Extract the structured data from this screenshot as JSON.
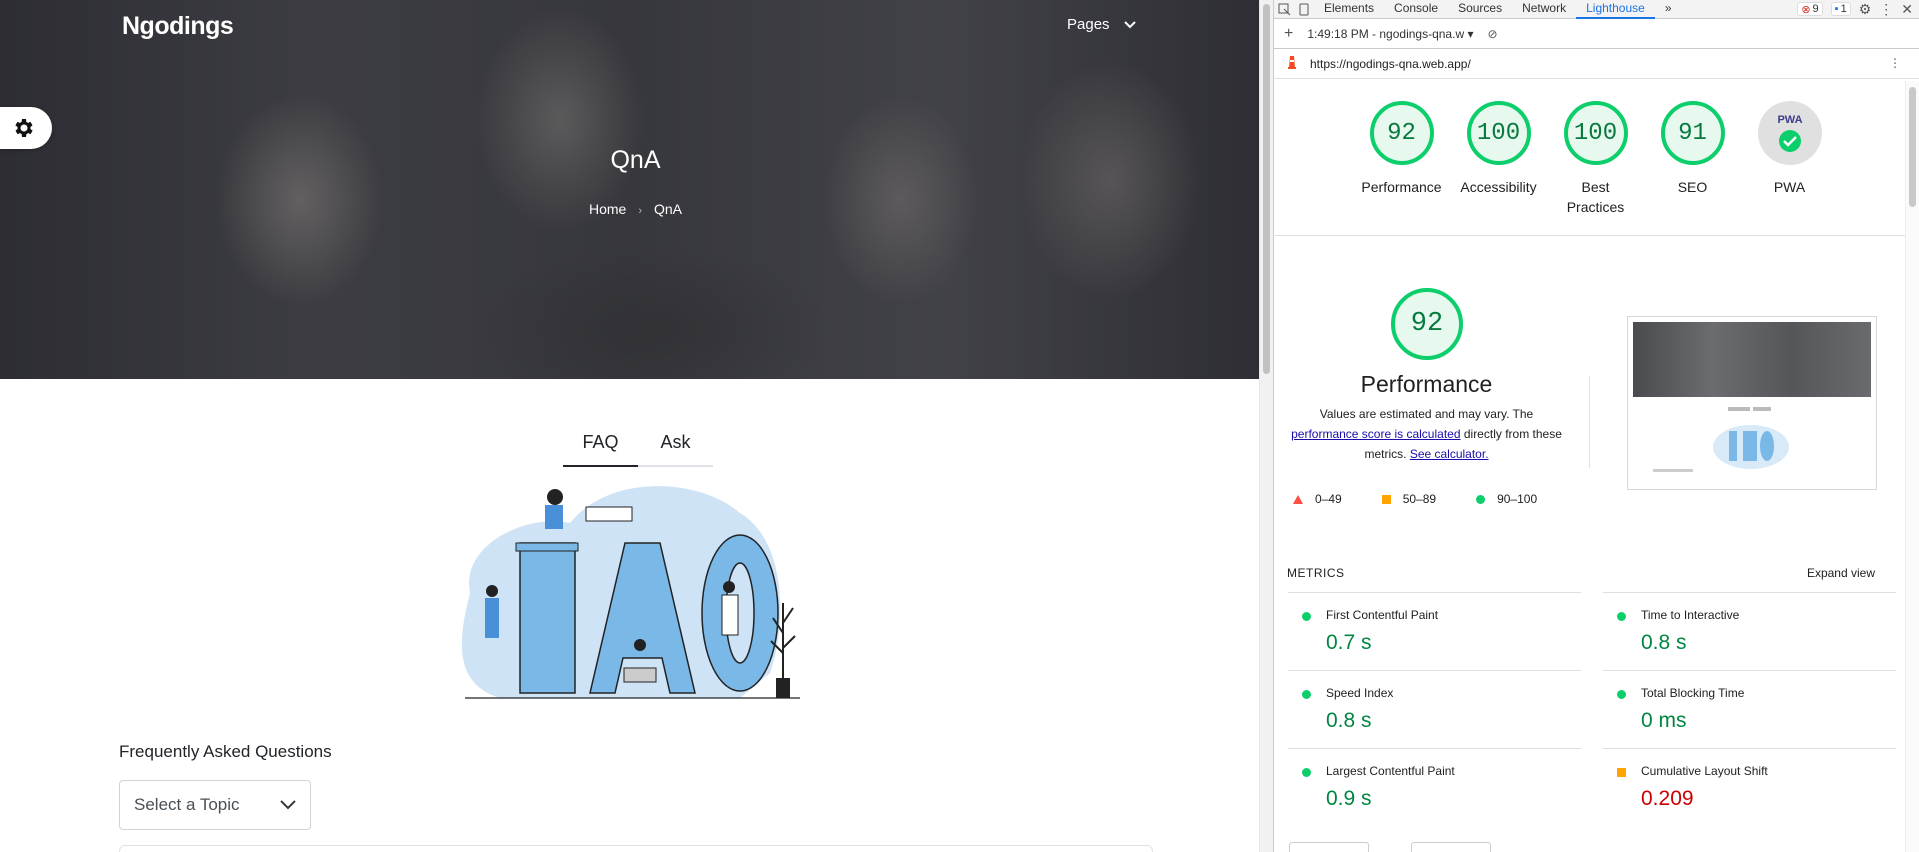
{
  "site": {
    "brand": "Ngodings",
    "nav_pages": "Pages",
    "hero_title": "QnA",
    "breadcrumb": {
      "home": "Home",
      "current": "QnA"
    },
    "tabs": [
      {
        "label": "FAQ"
      },
      {
        "label": "Ask"
      }
    ],
    "faq_heading": "Frequently Asked Questions",
    "topic_select": "Select a Topic"
  },
  "devtools": {
    "tabs": [
      "Elements",
      "Console",
      "Sources",
      "Network",
      "Lighthouse"
    ],
    "active_tab": "Lighthouse",
    "error_count": "9",
    "message_count": "1",
    "report_label": "1:49:18 PM - ngodings-qna.w",
    "url": "https://ngodings-qna.web.app/"
  },
  "lighthouse": {
    "gauges": [
      {
        "score": "92",
        "label": "Performance"
      },
      {
        "score": "100",
        "label": "Accessibility"
      },
      {
        "score": "100",
        "label": "Best Practices"
      },
      {
        "score": "91",
        "label": "SEO"
      },
      {
        "score": "",
        "label": "PWA"
      }
    ],
    "pwa_badge_text": "PWA",
    "performance": {
      "score": "92",
      "title": "Performance",
      "desc_pre": "Values are estimated and may vary. The ",
      "desc_link": "performance score is calculated",
      "desc_mid": " directly from these metrics. ",
      "desc_link2": "See calculator."
    },
    "legend": [
      "0–49",
      "50–89",
      "90–100"
    ],
    "metrics_header": "METRICS",
    "expand_view": "Expand view",
    "metrics": [
      {
        "name": "First Contentful Paint",
        "value": "0.7 s",
        "status": "good"
      },
      {
        "name": "Time to Interactive",
        "value": "0.8 s",
        "status": "good"
      },
      {
        "name": "Speed Index",
        "value": "0.8 s",
        "status": "good"
      },
      {
        "name": "Total Blocking Time",
        "value": "0 ms",
        "status": "good"
      },
      {
        "name": "Largest Contentful Paint",
        "value": "0.9 s",
        "status": "good"
      },
      {
        "name": "Cumulative Layout Shift",
        "value": "0.209",
        "status": "average"
      }
    ],
    "colors": {
      "pass": "#0cce6b",
      "average": "#ffa400",
      "fail": "#ff4e42"
    }
  }
}
